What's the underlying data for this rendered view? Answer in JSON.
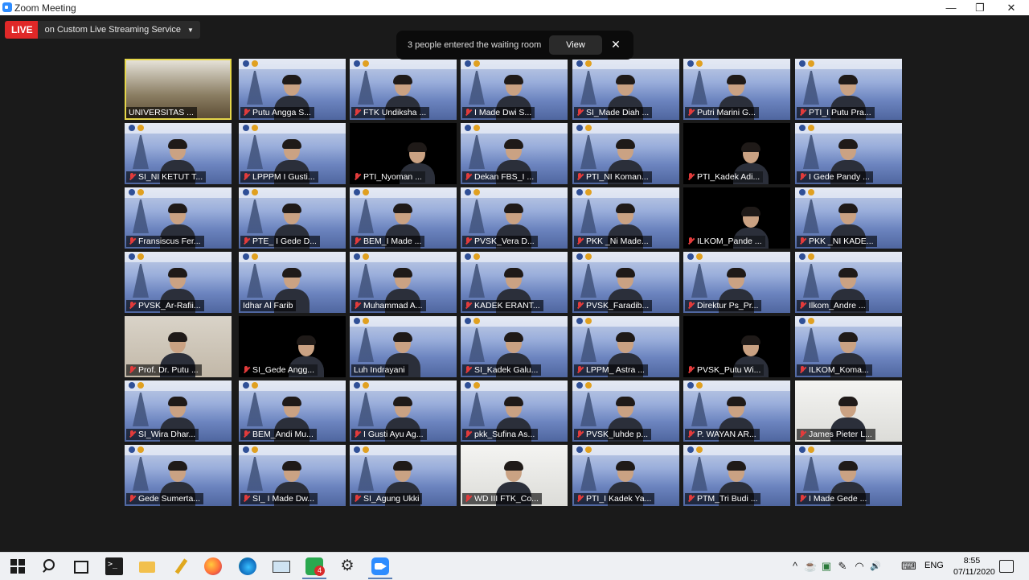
{
  "window": {
    "title": "Zoom Meeting",
    "buttons": [
      "—",
      "❐",
      "✕"
    ]
  },
  "live": {
    "badge": "LIVE",
    "service": "on Custom Live Streaming Service",
    "caret": "▼"
  },
  "notification": {
    "message": "3 people entered the waiting room",
    "view_label": "View",
    "close_label": "✕"
  },
  "participants": [
    {
      "name": "UNIVERSITAS ...",
      "muted": false,
      "bg": "stage",
      "active": true
    },
    {
      "name": "Putu Angga S...",
      "muted": true,
      "bg": "banner"
    },
    {
      "name": "FTK Undiksha ...",
      "muted": true,
      "bg": "banner"
    },
    {
      "name": "I Made Dwi S...",
      "muted": true,
      "bg": "banner"
    },
    {
      "name": "SI_Made Diah ...",
      "muted": true,
      "bg": "banner"
    },
    {
      "name": "Putri Marini G...",
      "muted": true,
      "bg": "banner"
    },
    {
      "name": "PTI_I Putu Pra...",
      "muted": true,
      "bg": "banner"
    },
    {
      "name": "SI_NI KETUT T...",
      "muted": true,
      "bg": "banner"
    },
    {
      "name": "LPPPM I Gusti...",
      "muted": true,
      "bg": "banner"
    },
    {
      "name": "PTI_Nyoman ...",
      "muted": true,
      "bg": "bare"
    },
    {
      "name": "Dekan FBS_I ...",
      "muted": true,
      "bg": "banner"
    },
    {
      "name": "PTI_NI Koman...",
      "muted": true,
      "bg": "banner"
    },
    {
      "name": "PTI_Kadek Adi...",
      "muted": true,
      "bg": "bare"
    },
    {
      "name": "I Gede Pandy ...",
      "muted": true,
      "bg": "banner"
    },
    {
      "name": "Fransiscus Fer...",
      "muted": true,
      "bg": "banner"
    },
    {
      "name": "PTE_ I Gede D...",
      "muted": true,
      "bg": "banner"
    },
    {
      "name": "BEM_I Made ...",
      "muted": true,
      "bg": "banner"
    },
    {
      "name": "PVSK_Vera D...",
      "muted": true,
      "bg": "banner"
    },
    {
      "name": "PKK _Ni Made...",
      "muted": true,
      "bg": "banner"
    },
    {
      "name": "ILKOM_Pande ...",
      "muted": true,
      "bg": "bare"
    },
    {
      "name": "PKK _NI KADE...",
      "muted": true,
      "bg": "banner"
    },
    {
      "name": "PVSK_Ar-Rafii...",
      "muted": true,
      "bg": "banner"
    },
    {
      "name": "Idhar Al Farib",
      "muted": false,
      "bg": "banner"
    },
    {
      "name": "Muhammad A...",
      "muted": true,
      "bg": "banner"
    },
    {
      "name": "KADEK ERANT...",
      "muted": true,
      "bg": "banner"
    },
    {
      "name": "PVSK_Faradib...",
      "muted": true,
      "bg": "banner"
    },
    {
      "name": "Direktur Ps_Pr...",
      "muted": true,
      "bg": "banner"
    },
    {
      "name": "Ilkom_Andre ...",
      "muted": true,
      "bg": "banner"
    },
    {
      "name": "Prof. Dr. Putu ...",
      "muted": true,
      "bg": "room"
    },
    {
      "name": "SI_Gede Angg...",
      "muted": true,
      "bg": "bare"
    },
    {
      "name": "Luh Indrayani",
      "muted": false,
      "bg": "banner"
    },
    {
      "name": "SI_Kadek Galu...",
      "muted": true,
      "bg": "banner"
    },
    {
      "name": "LPPM_ Astra ...",
      "muted": true,
      "bg": "banner"
    },
    {
      "name": "PVSK_Putu Wi...",
      "muted": true,
      "bg": "bare"
    },
    {
      "name": "ILKOM_Koma...",
      "muted": true,
      "bg": "banner"
    },
    {
      "name": "SI_Wira Dhar...",
      "muted": true,
      "bg": "banner"
    },
    {
      "name": "BEM_Andi Mu...",
      "muted": true,
      "bg": "banner"
    },
    {
      "name": "I Gusti Ayu Ag...",
      "muted": true,
      "bg": "banner"
    },
    {
      "name": "pkk_Sufina As...",
      "muted": true,
      "bg": "banner"
    },
    {
      "name": "PVSK_luhde p...",
      "muted": true,
      "bg": "banner"
    },
    {
      "name": "P. WAYAN AR...",
      "muted": true,
      "bg": "banner"
    },
    {
      "name": "James Pieter L...",
      "muted": true,
      "bg": "bright"
    },
    {
      "name": "Gede Sumerta...",
      "muted": true,
      "bg": "banner"
    },
    {
      "name": "SI_ I Made Dw...",
      "muted": true,
      "bg": "banner"
    },
    {
      "name": "SI_Agung Ukki",
      "muted": true,
      "bg": "banner"
    },
    {
      "name": "WD III FTK_Co...",
      "muted": true,
      "bg": "bright"
    },
    {
      "name": "PTI_I Kadek Ya...",
      "muted": true,
      "bg": "banner"
    },
    {
      "name": "PTM_Tri Budi ...",
      "muted": true,
      "bg": "banner"
    },
    {
      "name": "I Made Gede ...",
      "muted": true,
      "bg": "banner"
    }
  ],
  "taskbar": {
    "apps": [
      "start-icon",
      "search-icon",
      "taskview-icon",
      "terminal-icon",
      "folder-icon",
      "pen-icon",
      "firefox-icon",
      "edge-icon",
      "desktop-icon",
      "whatsapp-icon",
      "settings-icon",
      "zoom-icon"
    ],
    "whatsapp_badge": "4",
    "tray_glyphs": [
      "^",
      "☕",
      "▣",
      "✎",
      "◠",
      "🔊",
      "⌨"
    ],
    "language": "ENG",
    "time": "8:55",
    "date": "07/11/2020"
  }
}
